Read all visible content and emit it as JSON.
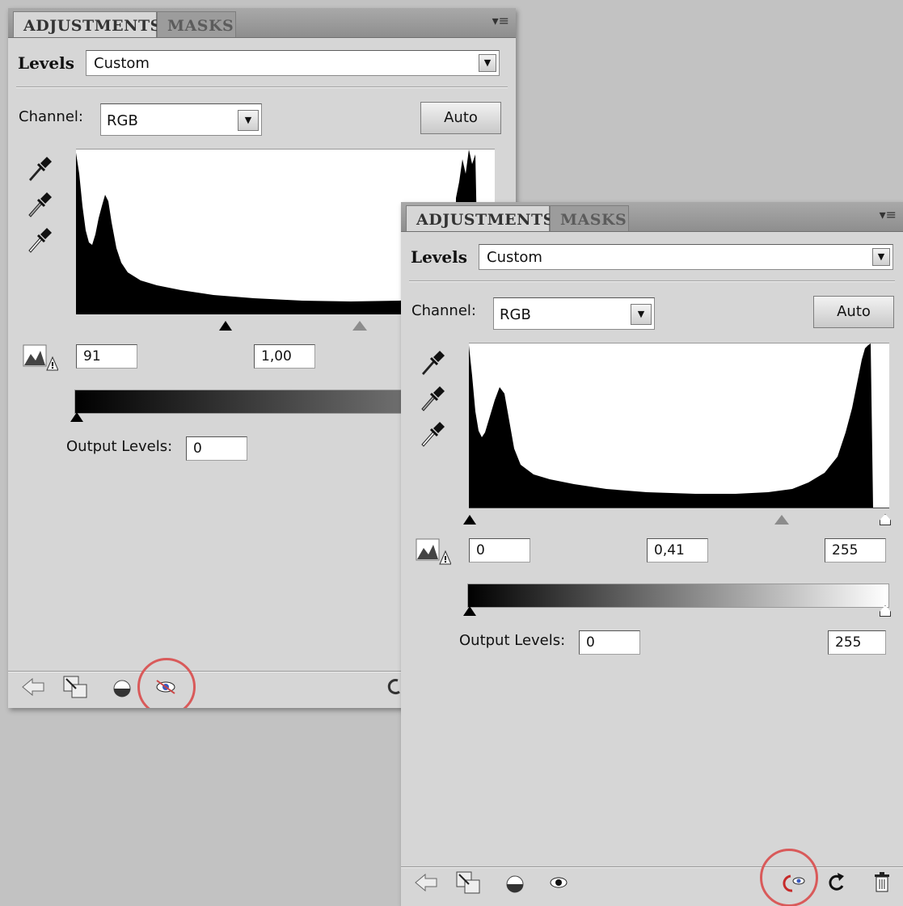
{
  "colors": {
    "highlight": "#d95a5a",
    "panel_bg": "#d6d6d6",
    "background": "#c2c2c2"
  },
  "panels": [
    {
      "tabs": {
        "active": "ADJUSTMENTS",
        "inactive": "MASKS"
      },
      "title": "Levels",
      "preset": "Custom",
      "channel_label": "Channel:",
      "channel": "RGB",
      "auto_label": "Auto",
      "input_levels": {
        "black": "91",
        "gamma": "1,00"
      },
      "output_label": "Output Levels:",
      "output_levels": {
        "black": "0"
      },
      "highlighted_icon": "visibility-toggle-icon"
    },
    {
      "tabs": {
        "active": "ADJUSTMENTS",
        "inactive": "MASKS"
      },
      "title": "Levels",
      "preset": "Custom",
      "channel_label": "Channel:",
      "channel": "RGB",
      "auto_label": "Auto",
      "input_levels": {
        "black": "0",
        "gamma": "0,41",
        "white": "255"
      },
      "output_label": "Output Levels:",
      "output_levels": {
        "black": "0",
        "white": "255"
      },
      "highlighted_icon": "view-previous-state-icon"
    }
  ]
}
